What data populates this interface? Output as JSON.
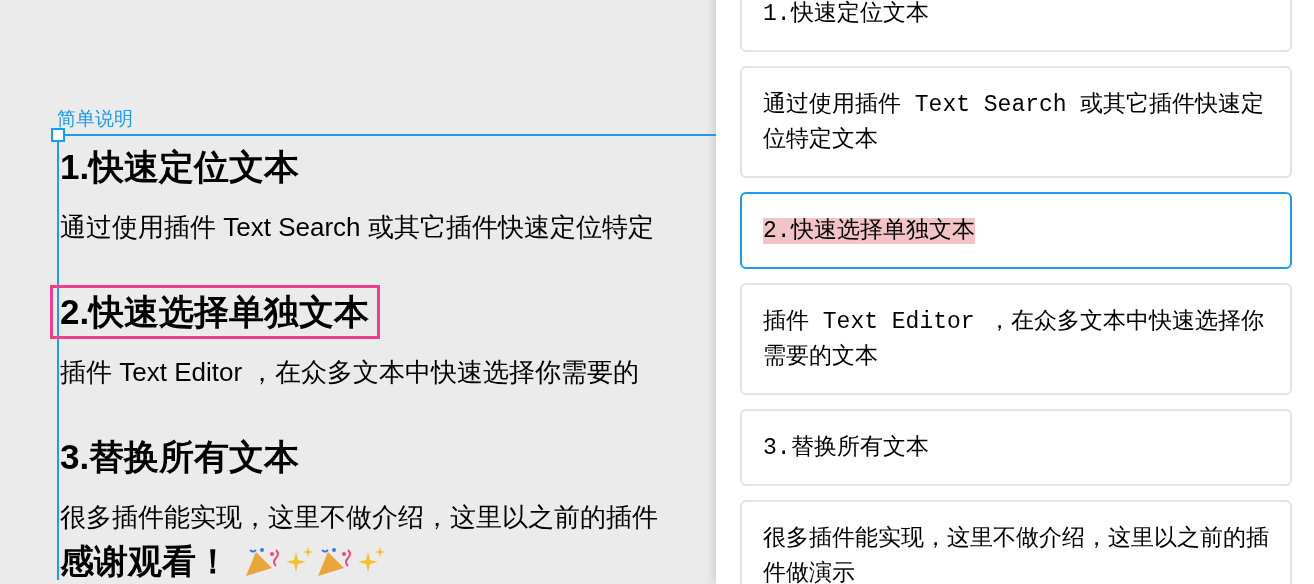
{
  "frame": {
    "label": "简单说明",
    "blocks": [
      {
        "kind": "heading",
        "text": "1.快速定位文本",
        "selected": false
      },
      {
        "kind": "body",
        "text": "通过使用插件 Text Search 或其它插件快速定位特定"
      },
      {
        "kind": "heading",
        "text": "2.快速选择单独文本",
        "selected": true
      },
      {
        "kind": "body",
        "text": "插件 Text Editor ，在众多文本中快速选择你需要的"
      },
      {
        "kind": "heading",
        "text": "3.替换所有文本",
        "selected": false
      },
      {
        "kind": "body",
        "text": "很多插件能实现，这里不做介绍，这里以之前的插件"
      },
      {
        "kind": "closing",
        "text": "感谢观看！"
      }
    ]
  },
  "panel": {
    "cards": [
      {
        "text": "1.快速定位文本",
        "selected": false
      },
      {
        "text": "通过使用插件 Text Search 或其它插件快速定位特定文本",
        "selected": false
      },
      {
        "text": "2.快速选择单独文本",
        "selected": true
      },
      {
        "text": "插件 Text Editor ，在众多文本中快速选择你需要的文本",
        "selected": false
      },
      {
        "text": "3.替换所有文本",
        "selected": false
      },
      {
        "text": "很多插件能实现，这里不做介绍，这里以之前的插件做演示",
        "selected": false
      }
    ]
  }
}
